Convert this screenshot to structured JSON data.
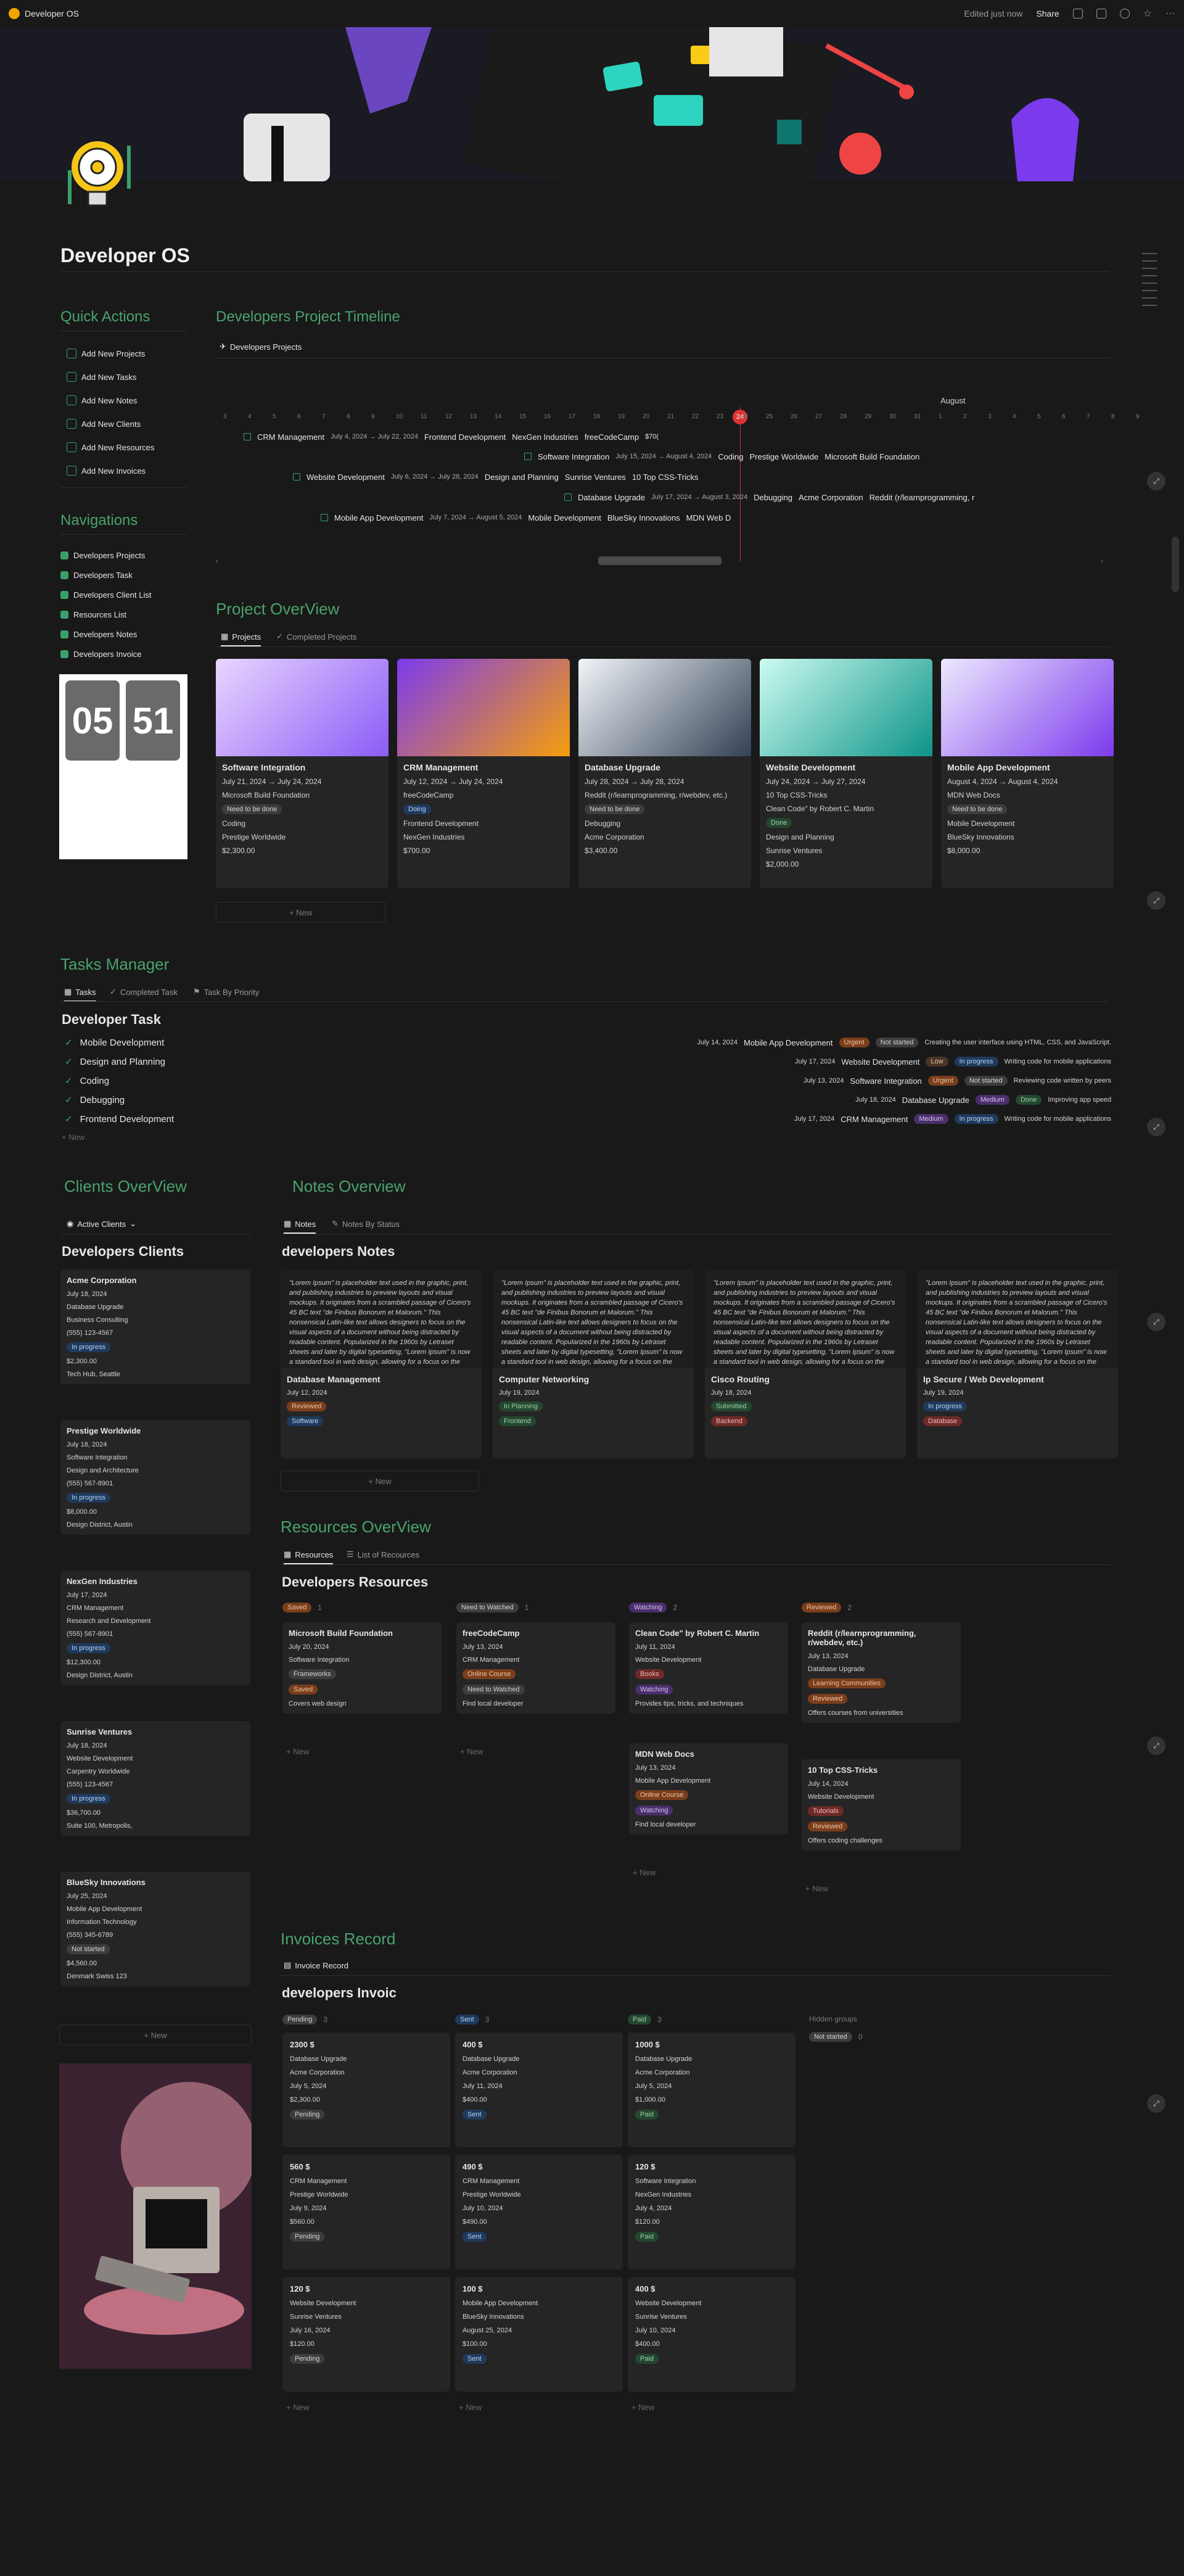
{
  "topbar": {
    "title": "Developer OS",
    "edited": "Edited just now",
    "share": "Share"
  },
  "page": {
    "title": "Developer OS"
  },
  "quick_actions": {
    "heading": "Quick Actions",
    "items": [
      "Add New Projects",
      "Add New Tasks",
      "Add New Notes",
      "Add New Clients",
      "Add New Resources",
      "Add New Invoices"
    ]
  },
  "navigations": {
    "heading": "Navigations",
    "items": [
      "Developers Projects",
      "Developers Task",
      "Developers Client List",
      "Resources List",
      "Developers Notes",
      "Developers Invoice"
    ]
  },
  "clock": {
    "hour": "05",
    "minute": "51"
  },
  "timeline": {
    "heading": "Developers Project Timeline",
    "view": "Developers Projects",
    "month": "August",
    "days": [
      "3",
      "4",
      "5",
      "6",
      "7",
      "8",
      "9",
      "10",
      "11",
      "12",
      "13",
      "14",
      "15",
      "16",
      "17",
      "18",
      "19",
      "20",
      "21",
      "22",
      "23",
      "24",
      "25",
      "26",
      "27",
      "28",
      "29",
      "30",
      "31",
      "1",
      "2",
      "3",
      "4",
      "5",
      "6",
      "7",
      "8",
      "9"
    ],
    "today": "24",
    "bars": [
      {
        "name": "CRM Management",
        "dates": "July 4, 2024 → July 22, 2024",
        "tags": [
          "Frontend Development",
          "NexGen Industries",
          "freeCodeCamp",
          "$70("
        ]
      },
      {
        "name": "Software Integration",
        "dates": "July 15, 2024 → August 4, 2024",
        "tags": [
          "Coding",
          "Prestige Worldwide",
          "Microsoft Build Foundation"
        ]
      },
      {
        "name": "Website Development",
        "dates": "July 6, 2024 → July 28, 2024",
        "tags": [
          "Design and Planning",
          "Sunrise Ventures",
          "10 Top CSS-Tricks"
        ]
      },
      {
        "name": "Database Upgrade",
        "dates": "July 17, 2024 → August 3, 2024",
        "tags": [
          "Debugging",
          "Acme Corporation",
          "Reddit (r/learnprogramming, r"
        ]
      },
      {
        "name": "Mobile App Development",
        "dates": "July 7, 2024 → August 5, 2024",
        "tags": [
          "Mobile Development",
          "BlueSky Innovations",
          "MDN Web D"
        ]
      }
    ]
  },
  "project_overview": {
    "heading": "Project OverView",
    "tabs": [
      "Projects",
      "Completed Projects"
    ],
    "new": "+ New",
    "cards": [
      {
        "name": "Software Integration",
        "dates": "July 21, 2024 → July 24, 2024",
        "resource": "Microsoft Build Foundation",
        "status": "Need to be done",
        "task": "Coding",
        "client": "Prestige Worldwide",
        "amount": "$2,300.00"
      },
      {
        "name": "CRM Management",
        "dates": "July 12, 2024 → July 24, 2024",
        "resource": "freeCodeCamp",
        "status": "Doing",
        "task": "Frontend Development",
        "client": "NexGen Industries",
        "amount": "$700.00"
      },
      {
        "name": "Database Upgrade",
        "dates": "July 28, 2024 → July 28, 2024",
        "resource": "Reddit (r/learnprogramming, r/webdev, etc.)",
        "status": "Need to be done",
        "task": "Debugging",
        "client": "Acme Corporation",
        "amount": "$3,400.00"
      },
      {
        "name": "Website Development",
        "dates": "July 24, 2024 → July 27, 2024",
        "resource": "10 Top CSS-Tricks",
        "resource2": "Clean Code\" by Robert C. Martin",
        "status": "Done",
        "task": "Design and Planning",
        "client": "Sunrise Ventures",
        "amount": "$2,000.00"
      },
      {
        "name": "Mobile App Development",
        "dates": "August 4, 2024 → August 4, 2024",
        "resource": "MDN Web Docs",
        "status": "Need to be done",
        "task": "Mobile Development",
        "client": "BlueSky Innovations",
        "amount": "$8,000.00"
      }
    ]
  },
  "tasks": {
    "heading": "Tasks Manager",
    "tabs": [
      "Tasks",
      "Completed Task",
      "Task By Priority"
    ],
    "title": "Developer Task",
    "list": [
      "Mobile Development",
      "Design and Planning",
      "Coding",
      "Debugging",
      "Frontend Development"
    ],
    "new": "+ New",
    "rows": [
      {
        "date": "July 14, 2024",
        "project": "Mobile App Development",
        "priority": "Urgent",
        "status": "Not started",
        "desc": "Creating the user interface using HTML, CSS, and JavaScript."
      },
      {
        "date": "July 17, 2024",
        "project": "Website Development",
        "priority": "Low",
        "status": "In progress",
        "desc": "Writing code for mobile applications"
      },
      {
        "date": "July 13, 2024",
        "project": "Software Integration",
        "priority": "Urgent",
        "status": "Not started",
        "desc": "Reviewing code written by peers"
      },
      {
        "date": "July 18, 2024",
        "project": "Database Upgrade",
        "priority": "Medium",
        "status": "Done",
        "desc": "Improving app speed"
      },
      {
        "date": "July 17, 2024",
        "project": "CRM Management",
        "priority": "Medium",
        "status": "In progress",
        "desc": "Writing code for mobile applications"
      }
    ]
  },
  "clients": {
    "heading": "Clients OverView",
    "view": "Active Clients",
    "title": "Developers Clients",
    "new": "+ New",
    "list": [
      {
        "name": "Acme Corporation",
        "date": "July 18, 2024",
        "project": "Database Upgrade",
        "industry": "Business Consulting",
        "phone": "(555) 123-4567",
        "status": "In progress",
        "amount": "$2,300.00",
        "address": "Tech Hub, Seattle"
      },
      {
        "name": "Prestige Worldwide",
        "date": "July 18, 2024",
        "project": "Software Integration",
        "industry": "Design and Architecture",
        "phone": "(555) 567-8901",
        "status": "In progress",
        "amount": "$8,000.00",
        "address": "Design District, Austin"
      },
      {
        "name": "NexGen Industries",
        "date": "July 17, 2024",
        "project": "CRM Management",
        "industry": "Research and Development",
        "phone": "(555) 567-8901",
        "status": "In progress",
        "amount": "$12,300.00",
        "address": "Design District, Austin"
      },
      {
        "name": "Sunrise Ventures",
        "date": "July 18, 2024",
        "project": "Website Development",
        "industry": "Carpentry Worldwide",
        "phone": "(555) 123-4567",
        "status": "In progress",
        "amount": "$36,700.00",
        "address": "Suite 100, Metropolis,"
      },
      {
        "name": "BlueSky Innovations",
        "date": "July 25, 2024",
        "project": "Mobile App Development",
        "industry": "Information Technology",
        "phone": "(555) 345-6789",
        "status": "Not started",
        "amount": "$4,560.00",
        "address": "Denmark Swiss 123"
      }
    ]
  },
  "notes": {
    "heading": "Notes Overview",
    "tabs": [
      "Notes",
      "Notes By Status"
    ],
    "title": "developers Notes",
    "new": "+ New",
    "lorem": "\"Lorem Ipsum\" is placeholder text used in the graphic, print, and publishing industries to preview layouts and visual mockups. It originates from a scrambled passage of Cicero's 45 BC text \"de Finibus Bonorum et Malorum.\" This nonsensical Latin-like text allows designers to focus on the visual aspects of a document without being distracted by readable content. Popularized in the 1960s by Letraset sheets and later by digital typesetting, \"Lorem Ipsum\" is now a standard tool in web design, allowing for a focus on the aesthetic and structural elements of a design.",
    "list": [
      {
        "name": "Database Management",
        "date": "July 12, 2024",
        "status": "Reviewed",
        "tag": "Software"
      },
      {
        "name": "Computer Networking",
        "date": "July 19, 2024",
        "status": "In Planning",
        "tag": "Frontend"
      },
      {
        "name": "Cisco Routing",
        "date": "July 18, 2024",
        "status": "Submitted",
        "tag": "Backend"
      },
      {
        "name": "Ip Secure / Web Development",
        "date": "July 19, 2024",
        "status": "In progress",
        "tag": "Database"
      }
    ]
  },
  "resources": {
    "heading": "Resources OverView",
    "tabs": [
      "Resources",
      "List of Recources"
    ],
    "title": "Developers Resources",
    "new": "+ New",
    "columns": [
      {
        "label": "Saved",
        "count": "1",
        "items": [
          {
            "name": "Microsoft Build Foundation",
            "date": "July 20, 2024",
            "project": "Software Integration",
            "type": "Frameworks",
            "status": "Saved",
            "note": "Covers web design"
          }
        ]
      },
      {
        "label": "Need to Watched",
        "count": "1",
        "items": [
          {
            "name": "freeCodeCamp",
            "date": "July 13, 2024",
            "project": "CRM Management",
            "type": "Online Course",
            "status": "Need to Watched",
            "note": "Find local developer"
          }
        ]
      },
      {
        "label": "Watching",
        "count": "2",
        "items": [
          {
            "name": "Clean Code\" by Robert C. Martin",
            "date": "July 11, 2024",
            "project": "Website Development",
            "type": "Books",
            "status": "Watching",
            "note": "Provides tips, tricks, and techniques"
          },
          {
            "name": "MDN Web Docs",
            "date": "July 13, 2024",
            "project": "Mobile App Development",
            "type": "Online Course",
            "status": "Watching",
            "note": "Find local developer"
          }
        ]
      },
      {
        "label": "Reviewed",
        "count": "2",
        "items": [
          {
            "name": "Reddit (r/learnprogramming, r/webdev, etc.)",
            "date": "July 13, 2024",
            "project": "Database Upgrade",
            "type": "Learning Communities",
            "status": "Reviewed",
            "note": "Offers courses from universities"
          },
          {
            "name": "10 Top CSS-Tricks",
            "date": "July 14, 2024",
            "project": "Website Development",
            "type": "Tutorials",
            "status": "Reviewed",
            "note": "Offers coding challenges"
          }
        ]
      }
    ]
  },
  "invoices": {
    "heading": "Invoices Record",
    "view": "Invoice Record",
    "title": "developers Invoic",
    "new": "+ New",
    "hidden": "Hidden groups",
    "hidden_item": "Not started",
    "hidden_count": "0",
    "columns": [
      {
        "label": "Pending",
        "count": "3",
        "items": [
          {
            "amount": "2300 $",
            "project": "Database Upgrade",
            "client": "Acme Corporation",
            "date": "July 5, 2024",
            "total": "$2,300.00",
            "status": "Pending"
          },
          {
            "amount": "560 $",
            "project": "CRM Management",
            "client": "Prestige Worldwide",
            "date": "July 9, 2024",
            "total": "$560.00",
            "status": "Pending"
          },
          {
            "amount": "120 $",
            "project": "Website Development",
            "client": "Sunrise Ventures",
            "date": "July 16, 2024",
            "total": "$120.00",
            "status": "Pending"
          }
        ]
      },
      {
        "label": "Sent",
        "count": "3",
        "items": [
          {
            "amount": "400 $",
            "project": "Database Upgrade",
            "client": "Acme Corporation",
            "date": "July 11, 2024",
            "total": "$400.00",
            "status": "Sent"
          },
          {
            "amount": "490 $",
            "project": "CRM Management",
            "client": "Prestige Worldwide",
            "date": "July 10, 2024",
            "total": "$490.00",
            "status": "Sent"
          },
          {
            "amount": "100 $",
            "project": "Mobile App Development",
            "client": "BlueSky Innovations",
            "date": "August 25, 2024",
            "total": "$100.00",
            "status": "Sent"
          }
        ]
      },
      {
        "label": "Paid",
        "count": "3",
        "items": [
          {
            "amount": "1000 $",
            "project": "Database Upgrade",
            "client": "Acme Corporation",
            "date": "July 5, 2024",
            "total": "$1,000.00",
            "status": "Paid"
          },
          {
            "amount": "120 $",
            "project": "Software Integration",
            "client": "NexGen Industries",
            "date": "July 4, 2024",
            "total": "$120.00",
            "status": "Paid"
          },
          {
            "amount": "400 $",
            "project": "Website Development",
            "client": "Sunrise Ventures",
            "date": "July 10, 2024",
            "total": "$400.00",
            "status": "Paid"
          }
        ]
      }
    ]
  },
  "colors": {
    "accent": "#4aa36c",
    "bg": "#191919",
    "card": "#252525"
  }
}
